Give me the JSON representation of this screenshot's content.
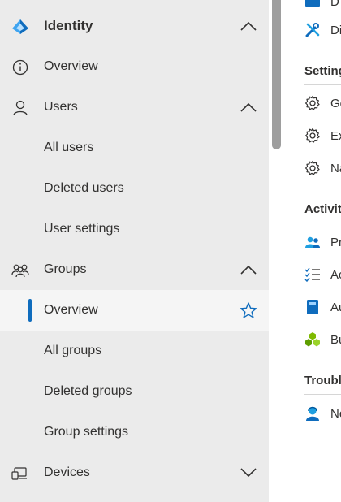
{
  "sidebar": {
    "header": {
      "label": "Identity",
      "chevron": "chevron-up-icon"
    },
    "items": [
      {
        "label": "Overview",
        "icon": "info-icon"
      },
      {
        "label": "Users",
        "icon": "user-icon",
        "chevron": "chevron-up-icon"
      },
      {
        "label": "All users"
      },
      {
        "label": "Deleted users"
      },
      {
        "label": "User settings"
      },
      {
        "label": "Groups",
        "icon": "groups-icon",
        "chevron": "chevron-up-icon"
      },
      {
        "label": "Overview",
        "selected": true,
        "favorite_icon": "star-icon"
      },
      {
        "label": "All groups"
      },
      {
        "label": "Deleted groups"
      },
      {
        "label": "Group settings"
      },
      {
        "label": "Devices",
        "icon": "devices-icon",
        "chevron": "chevron-down-icon"
      }
    ]
  },
  "right_panel": {
    "top_items": [
      {
        "label": "D",
        "icon": "folder-icon"
      },
      {
        "label": "Di",
        "icon": "tools-icon"
      }
    ],
    "sections": [
      {
        "title": "Setting",
        "items": [
          {
            "label": "Ge",
            "icon": "gear-icon"
          },
          {
            "label": "Ex",
            "icon": "gear-icon"
          },
          {
            "label": "Na",
            "icon": "gear-icon"
          }
        ]
      },
      {
        "title": "Activit",
        "items": [
          {
            "label": "Pr",
            "icon": "users-icon"
          },
          {
            "label": "Ac",
            "icon": "checklist-icon"
          },
          {
            "label": "Au",
            "icon": "book-icon"
          },
          {
            "label": "Bu",
            "icon": "cubes-icon"
          }
        ]
      },
      {
        "title": "Troubl",
        "items": [
          {
            "label": "Ne",
            "icon": "support-icon"
          }
        ]
      }
    ]
  },
  "colors": {
    "accent": "#0f6cbd",
    "sidebar_bg": "#ebebeb",
    "selected_bg": "#f5f5f5"
  }
}
